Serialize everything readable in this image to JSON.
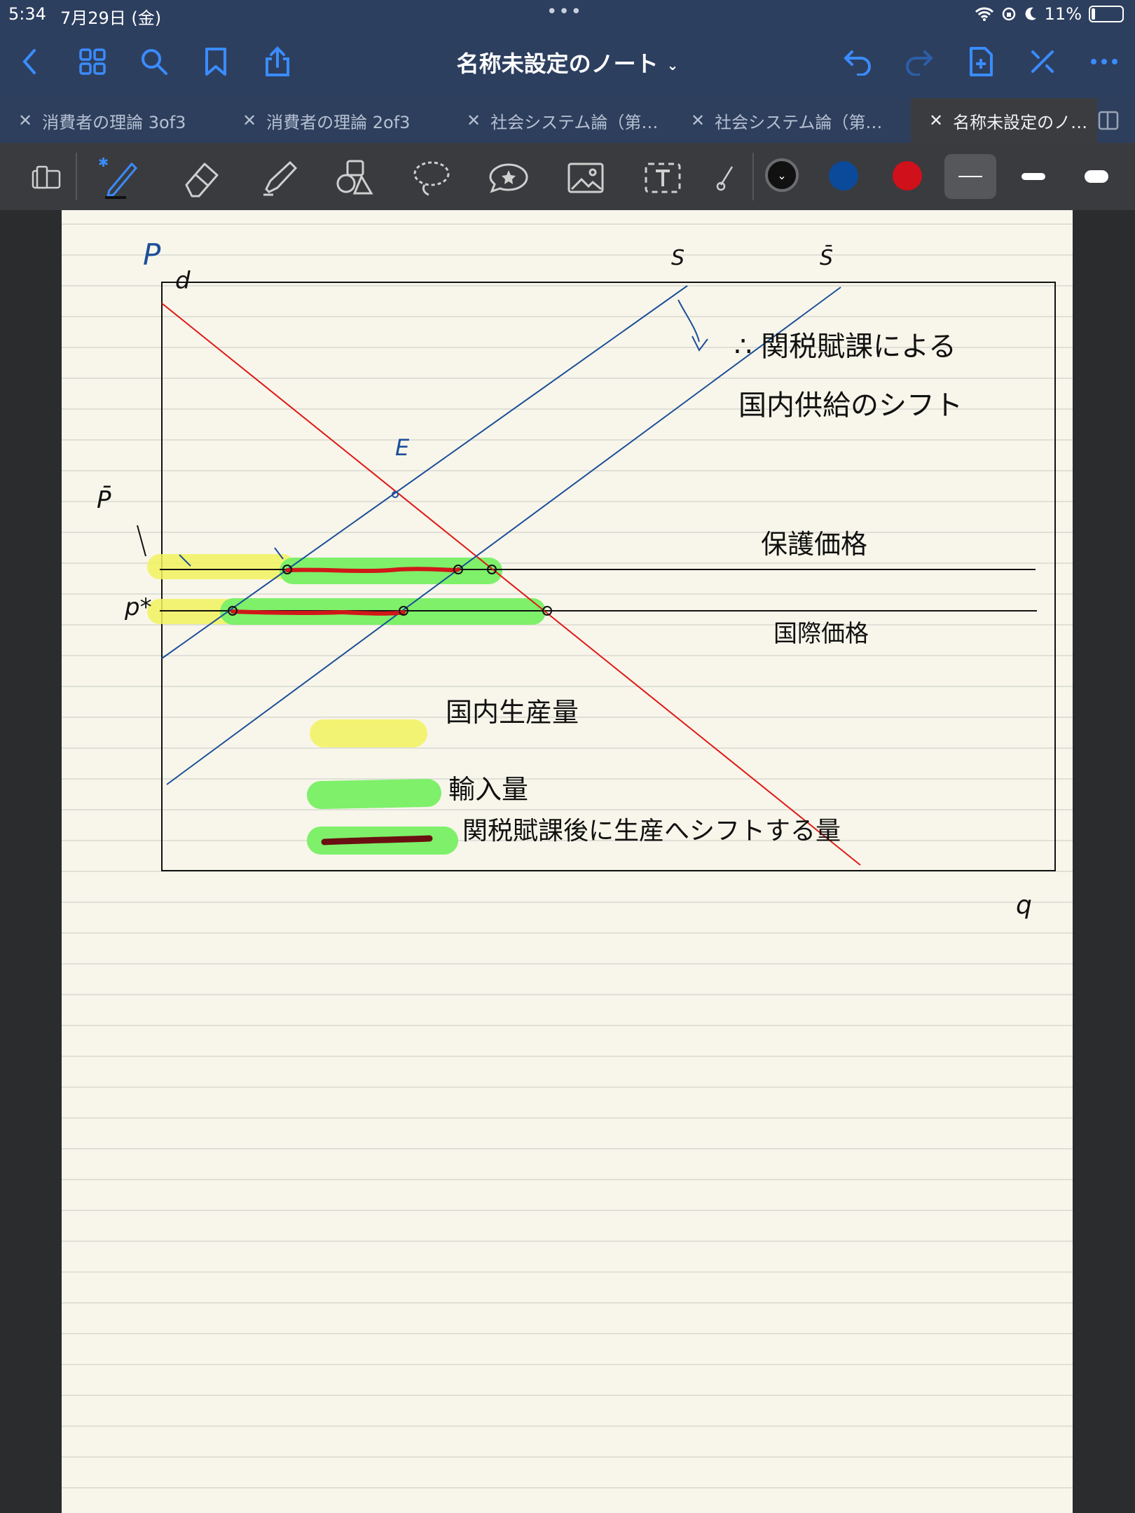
{
  "status_bar": {
    "time": "5:34",
    "date": "7月29日 (金)",
    "battery": "11%"
  },
  "nav": {
    "title": "名称未設定のノート"
  },
  "tabs": [
    {
      "label": "消費者の理論 3of3"
    },
    {
      "label": "消費者の理論 2of3"
    },
    {
      "label": "社会システム論（第…"
    },
    {
      "label": "社会システム論（第…"
    },
    {
      "label": "名称未設定のノ…"
    }
  ],
  "toolbar": {
    "colors": [
      "#111111",
      "#0b4a9a",
      "#d0101a"
    ],
    "icons": [
      "page-view-icon",
      "pen-icon",
      "eraser-icon",
      "highlighter-icon",
      "shapes-icon",
      "lasso-icon",
      "sticker-icon",
      "image-icon",
      "text-box-icon",
      "laser-icon"
    ]
  },
  "note": {
    "p_axis": "P",
    "q_axis": "q",
    "demand_label": "d",
    "supply_label": "S",
    "supply_shifted_label": "S̄",
    "equilibrium_label": "E",
    "p_bar_label": "P̄",
    "p_star_label": "p*",
    "shift_text_1": "∴ 関税賦課による",
    "shift_text_2": "国内供給のシフト",
    "protected_price": "保護価格",
    "world_price": "国際価格",
    "legend_domestic": "国内生産量",
    "legend_import": "輸入量",
    "legend_shift": "関税賦課後に生産へシフトする量"
  }
}
